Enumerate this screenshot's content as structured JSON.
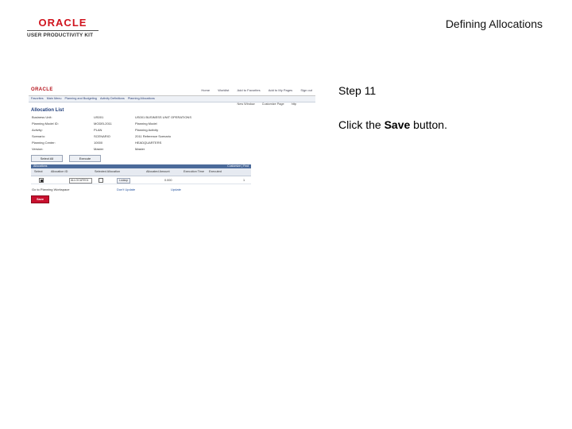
{
  "header": {
    "logo_brand": "ORACLE",
    "logo_product": "USER PRODUCTIVITY KIT",
    "title": "Defining Allocations"
  },
  "step": {
    "title": "Step 11",
    "instruction_prefix": "Click the ",
    "instruction_target": "Save",
    "instruction_suffix": " button."
  },
  "screenshot": {
    "brand": "ORACLE",
    "top_links": [
      "Home",
      "Worklist",
      "Add to Favorites",
      "Add to My Pages",
      "Sign out"
    ],
    "nav": [
      "Favorites",
      "Main Menu",
      "Planning and Budgeting",
      "Activity Definitions",
      "Planning Allocations"
    ],
    "utility_links": [
      "New Window",
      "Customize Page",
      "http"
    ],
    "page_heading": "Allocation List",
    "fields": [
      {
        "label": "Business Unit:",
        "value": "US001",
        "desc": "US001 BUSINESS UNIT OPERATIONS"
      },
      {
        "label": "Planning Model ID:",
        "value": "MODEL2011",
        "desc": "Planning Model"
      },
      {
        "label": "Activity:",
        "value": "PLAN",
        "desc": "Planning Activity"
      },
      {
        "label": "Scenario:",
        "value": "SCENARIO",
        "desc": "2011 Reference Scenario"
      },
      {
        "label": "Planning Center:",
        "value": "10000",
        "desc": "HEADQUARTERS"
      },
      {
        "label": "Version:",
        "value": "Master",
        "desc": "Master"
      }
    ],
    "buttons": {
      "select_all": "Select All",
      "execute": "Execute"
    },
    "grid": {
      "title": "Allocations",
      "nav": "Customize | Find",
      "columns": [
        "Select",
        "Allocation ID",
        "Selected Allocation",
        "Allocated Amount",
        "Execution Time",
        "Executed"
      ],
      "rows": [
        {
          "select_checked": true,
          "allocation_id": "ALLOCATE01",
          "selected_checked": false,
          "lookup": "Lookup",
          "amount": "0.000",
          "row_number": "1"
        }
      ]
    },
    "links": [
      "Go to Planning Workspace",
      "Don't Update",
      "Update"
    ],
    "save_button": "Save"
  }
}
